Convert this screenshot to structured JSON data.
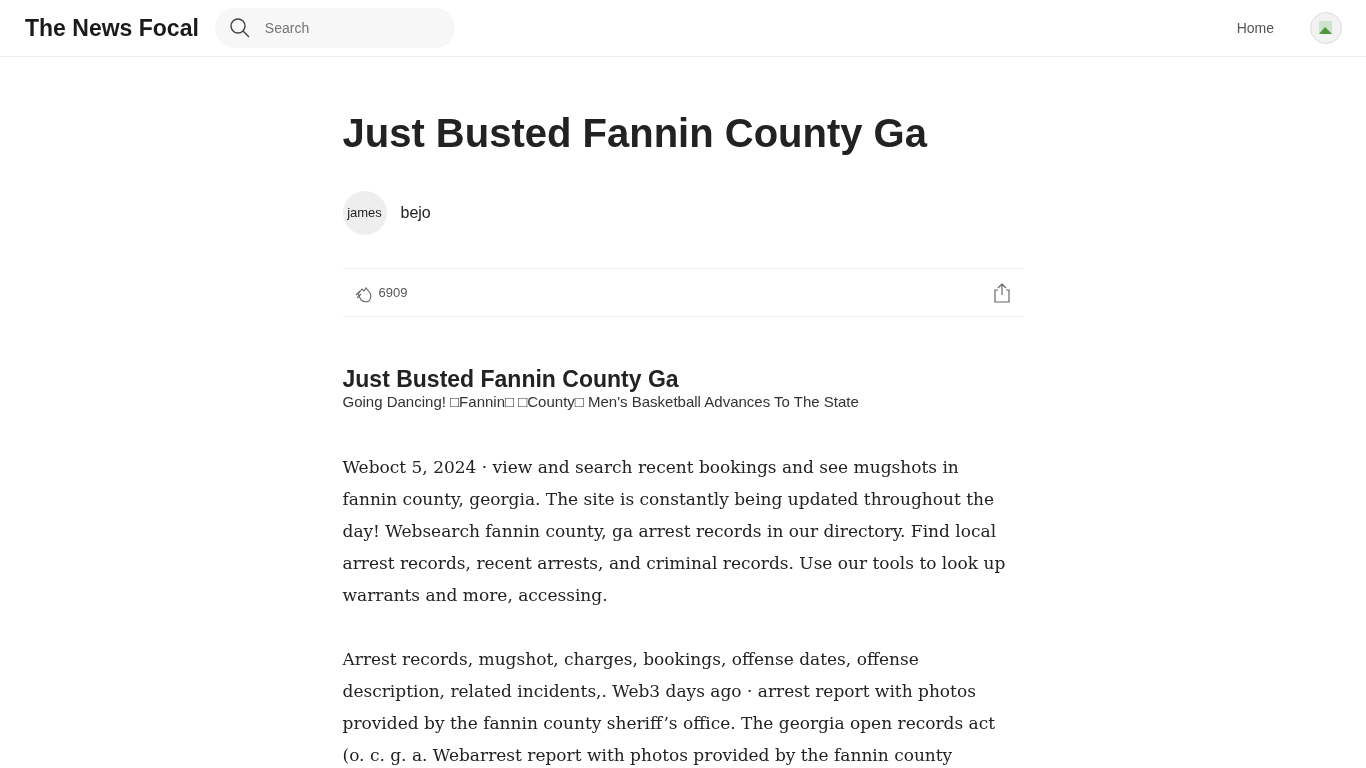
{
  "header": {
    "logo": "The News Focal",
    "search": {
      "placeholder": "Search"
    },
    "nav": [
      "Home"
    ]
  },
  "article": {
    "title": "Just Busted Fannin County Ga",
    "author": {
      "avatar_alt": "james",
      "name": "bejo"
    },
    "claps": "6909",
    "heading": "Just Busted Fannin County Ga",
    "image_alt": "Going Dancing! □Fannin□ □County□ Men's Basketball Advances To The State",
    "paragraphs": [
      "Weboct 5, 2024 · view and search recent bookings and see mugshots in fannin county, georgia. The site is constantly being updated throughout the day! Websearch fannin county, ga arrest records in our directory. Find local arrest records, recent arrests, and criminal records. Use our tools to look up warrants and more, accessing.",
      "Arrest records, mugshot, charges, bookings, offense dates, offense description, related incidents,. Web3 days ago · arrest report with photos provided by the fannin county sheriff’s office. The georgia open records act (o. c. g. a. Webarrest report with photos provided by the fannin county"
    ]
  }
}
